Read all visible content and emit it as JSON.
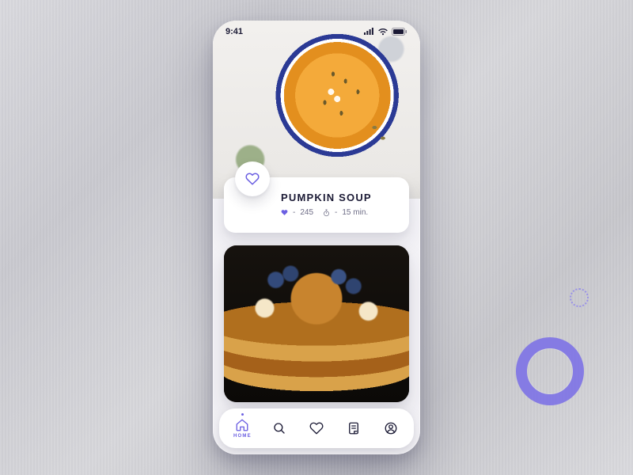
{
  "status": {
    "time": "9:41"
  },
  "recipe": {
    "title": "PUMPKIN SOUP",
    "likes_prefix": "- ",
    "likes": "245",
    "time_prefix": "- ",
    "time": "15 min."
  },
  "nav": {
    "home": "HOME"
  },
  "colors": {
    "accent": "#6b5fe2"
  }
}
